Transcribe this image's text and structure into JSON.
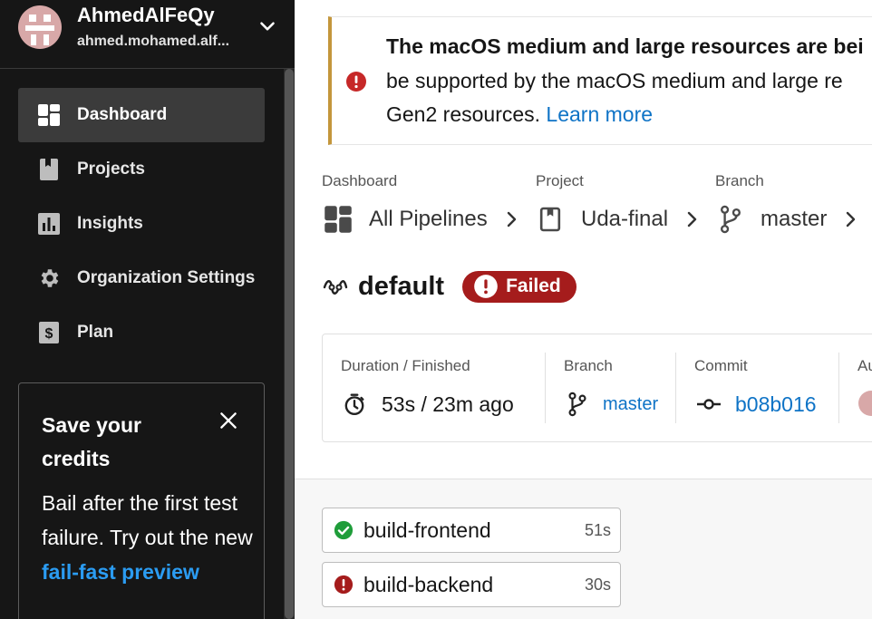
{
  "account": {
    "name": "AhmedAlFeQy",
    "email": "ahmed.mohamed.alf..."
  },
  "sidebar": {
    "items": [
      {
        "label": "Dashboard",
        "icon": "dashboard-icon",
        "active": true
      },
      {
        "label": "Projects",
        "icon": "projects-icon",
        "active": false
      },
      {
        "label": "Insights",
        "icon": "insights-icon",
        "active": false
      },
      {
        "label": "Organization Settings",
        "icon": "gear-icon",
        "active": false
      },
      {
        "label": "Plan",
        "icon": "plan-icon",
        "active": false
      }
    ]
  },
  "promo_card": {
    "title": "Save your credits",
    "body_text": "Bail after the first test failure. Try out the new",
    "link_text": "fail-fast preview"
  },
  "banner": {
    "title": "The macOS medium and large resources are bei",
    "line1": "be supported by the macOS medium and large re",
    "line2_prefix": "Gen2 resources.",
    "link": "Learn more"
  },
  "breadcrumbs": [
    {
      "label": "Dashboard",
      "value": "All Pipelines"
    },
    {
      "label": "Project",
      "value": "Uda-final"
    },
    {
      "label": "Branch",
      "value": "master"
    }
  ],
  "workflow": {
    "name": "default",
    "status": "Failed"
  },
  "details": {
    "duration": {
      "label": "Duration / Finished",
      "value": "53s / 23m ago"
    },
    "branch": {
      "label": "Branch",
      "value": "master"
    },
    "commit": {
      "label": "Commit",
      "value": "b08b016"
    },
    "author": {
      "label": "Au"
    }
  },
  "jobs": [
    {
      "name": "build-frontend",
      "duration": "51s",
      "status": "success"
    },
    {
      "name": "build-backend",
      "duration": "30s",
      "status": "failed"
    }
  ],
  "colors": {
    "sidebar_bg": "#161616",
    "failed": "#a51c1c",
    "success": "#1f9d3a",
    "link": "#0e73c6",
    "banner_accent": "#c4963b"
  }
}
